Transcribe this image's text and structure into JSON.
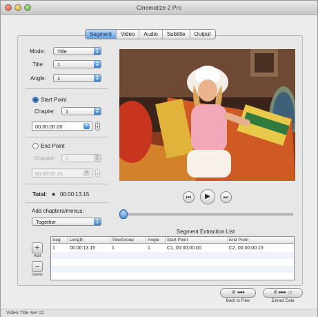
{
  "window": {
    "title": "Cinematize 2 Pro"
  },
  "tabs": [
    "Segment",
    "Video",
    "Audio",
    "Subtitle",
    "Output"
  ],
  "mode": {
    "label": "Mode:",
    "value": "Title"
  },
  "title_sel": {
    "label": "Title:",
    "value": "1"
  },
  "angle_sel": {
    "label": "Angle:",
    "value": "1"
  },
  "start_point": {
    "label": "Start Point",
    "chapter_label": "Chapter:",
    "chapter_value": "1",
    "time": "00:00:00.00"
  },
  "end_point": {
    "label": "End Point",
    "chapter_label": "Chapter:",
    "chapter_value": "2",
    "time": "00:00:00.15"
  },
  "total": {
    "label": "Total:",
    "time": "00:00:13.15"
  },
  "chapters_menus": {
    "label": "Add chapters/menus:",
    "value": "Together"
  },
  "transport": {
    "prev_icon": "skip-back-icon",
    "play_icon": "play-icon",
    "next_icon": "skip-forward-icon"
  },
  "segment_list": {
    "title": "Segment Extraction List",
    "columns": [
      "Seg",
      "Length",
      "Title/Group",
      "Angle",
      "Start Point",
      "End Point"
    ],
    "rows": [
      [
        "1",
        "00:00:13.15",
        "1",
        "1",
        "C1, 00:00:00.00",
        "C2, 00:00:00.15"
      ]
    ]
  },
  "list_buttons": {
    "add_label": "Add",
    "delete_label": "Delete",
    "add_symbol": "+",
    "delete_symbol": "−"
  },
  "nav": {
    "back_label": "Back to Files",
    "back_glyph": "⊘ ◂◂◂",
    "extract_label": "Extract Data",
    "extract_glyph": "⊘ ▸▸▸ ▭"
  },
  "status": {
    "text": "Video Title Set 02"
  }
}
